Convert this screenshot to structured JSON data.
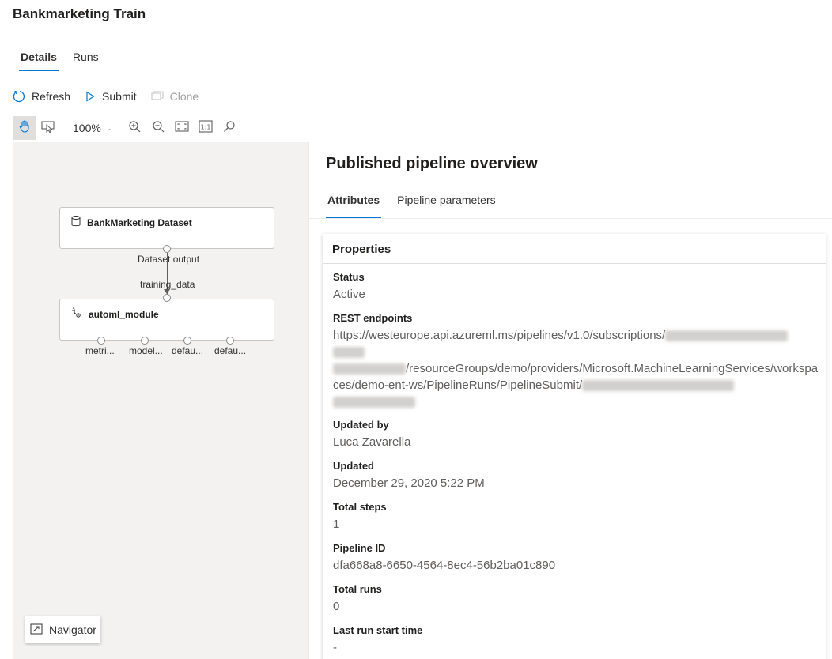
{
  "page": {
    "title": "Bankmarketing Train"
  },
  "tabs": [
    {
      "label": "Details",
      "active": true
    },
    {
      "label": "Runs",
      "active": false
    }
  ],
  "commands": {
    "refresh": "Refresh",
    "submit": "Submit",
    "clone": "Clone"
  },
  "toolbar": {
    "zoom": "100%",
    "icons": [
      "hand-pan-icon",
      "select-pointer-icon",
      "zoom-in-icon",
      "zoom-out-icon",
      "fit-screen-icon",
      "actual-size-icon",
      "search-icon"
    ]
  },
  "canvas": {
    "dataset_node": {
      "title": "BankMarketing Dataset",
      "output_label": "Dataset output"
    },
    "automl_node": {
      "title": "automl_module",
      "input_label": "training_data",
      "outputs": [
        "metri...",
        "model...",
        "defau...",
        "defau..."
      ]
    },
    "navigator": "Navigator"
  },
  "panel": {
    "title": "Published pipeline overview",
    "tabs": [
      {
        "label": "Attributes",
        "active": true
      },
      {
        "label": "Pipeline parameters",
        "active": false
      }
    ],
    "card_title": "Properties",
    "status": {
      "label": "Status",
      "value": "Active"
    },
    "rest": {
      "label": "REST endpoints",
      "part1": "https://westeurope.api.azureml.ms/pipelines/v1.0/subscriptions/",
      "part2": "/resourceGroups/demo/providers/Microsoft.MachineLearningServices/workspaces/demo-ent-ws/PipelineRuns/PipelineSubmit/"
    },
    "updated_by": {
      "label": "Updated by",
      "value": "Luca Zavarella"
    },
    "updated": {
      "label": "Updated",
      "value": "December 29, 2020 5:22 PM"
    },
    "total_steps": {
      "label": "Total steps",
      "value": "1"
    },
    "pipeline_id": {
      "label": "Pipeline ID",
      "value": "dfa668a8-6650-4564-8ec4-56b2ba01c890"
    },
    "total_runs": {
      "label": "Total runs",
      "value": "0"
    },
    "last_run": {
      "label": "Last run start time",
      "value": "-"
    }
  },
  "colors": {
    "accent": "#0078d4",
    "canvas_bg": "#f3f2f1"
  }
}
